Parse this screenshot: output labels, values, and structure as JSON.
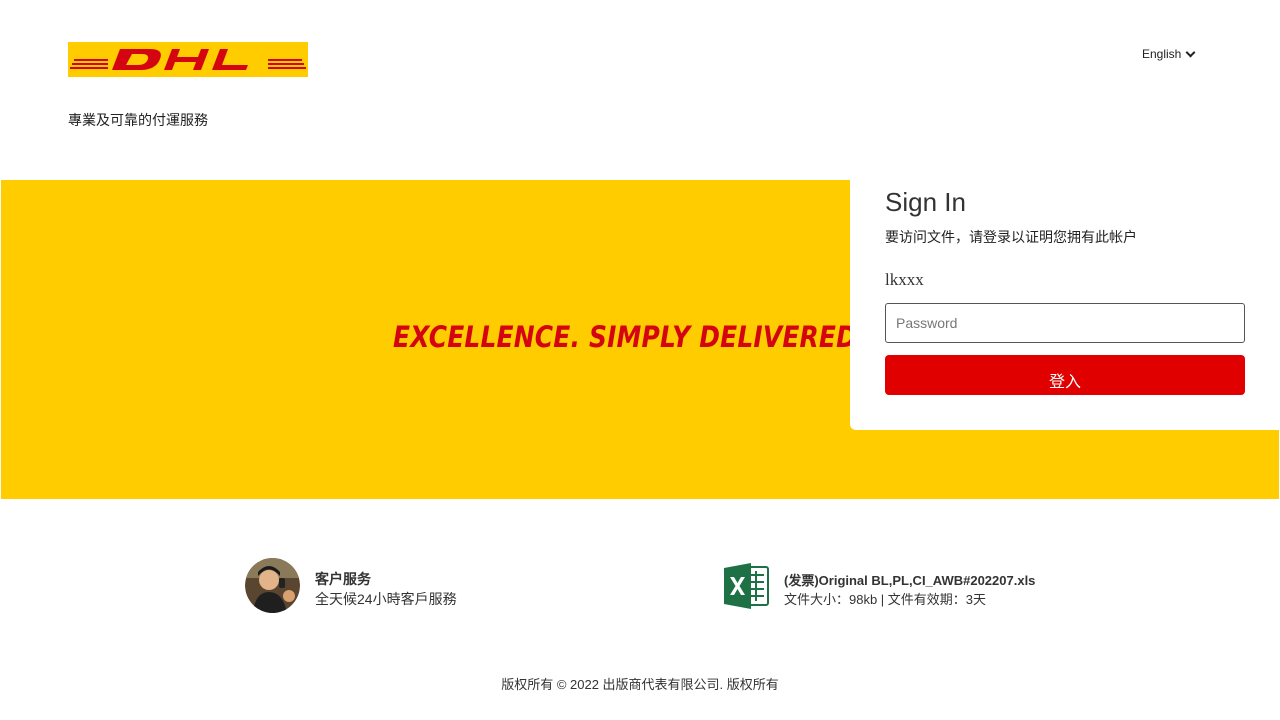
{
  "header": {
    "logo_text": "DHL",
    "language": "English",
    "tagline": "專業及可靠的付運服務"
  },
  "hero": {
    "slogan": "EXCELLENCE. SIMPLY DELIVERED"
  },
  "signin": {
    "title": "Sign In",
    "subtitle": "要访问文件，请登录以证明您拥有此帐户",
    "username": "lkxxx",
    "password_placeholder": "Password",
    "password_value": "",
    "submit_label": "登入"
  },
  "support": {
    "title": "客户服务",
    "subtitle": "全天候24小時客戶服務"
  },
  "file": {
    "name": "(发票)Original BL,PL,CI_AWB#202207.xls",
    "meta": "文件大小：98kb | 文件有效期：3天"
  },
  "footer": {
    "copyright": "版权所有 © 2022 出版商代表有限公司. 版权所有"
  },
  "colors": {
    "brand_yellow": "#ffcc00",
    "brand_red": "#d40511",
    "button_red": "#e00000",
    "excel_green": "#1e7145"
  },
  "icons": {
    "language_dropdown": "chevron-down-icon",
    "support_avatar": "agent-avatar",
    "file_type": "excel-icon"
  }
}
